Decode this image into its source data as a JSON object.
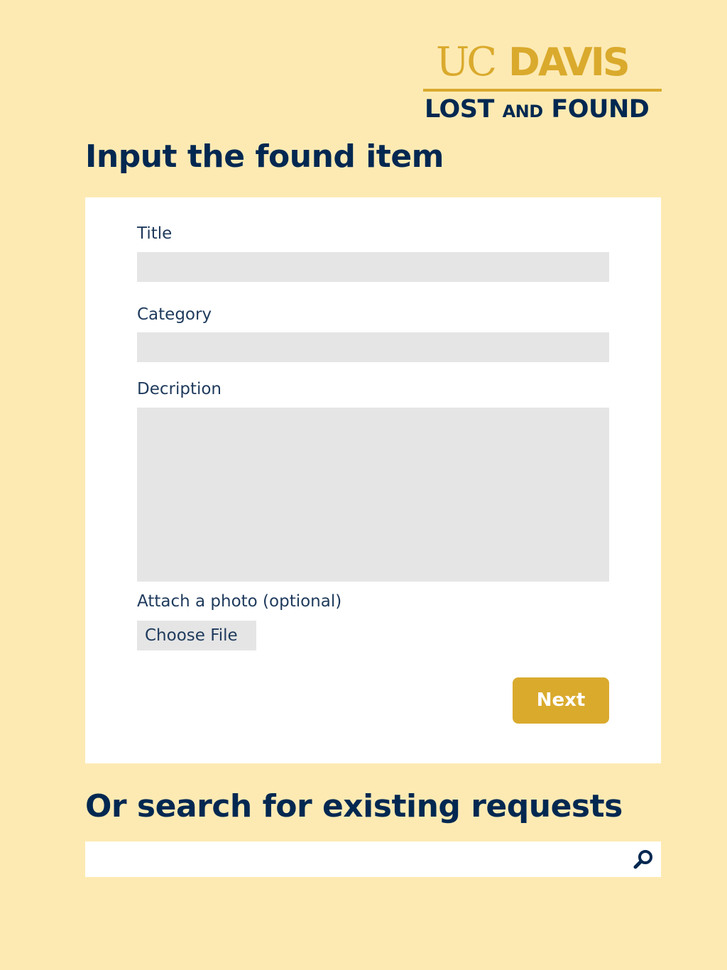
{
  "logo": {
    "uc": "UC",
    "davis": "DAVIS",
    "lost": "LOST",
    "and": "AND",
    "found": "FOUND"
  },
  "form": {
    "heading": "Input the found item",
    "title_label": "Title",
    "title_value": "",
    "category_label": "Category",
    "category_value": "",
    "description_label": "Decription",
    "description_value": "",
    "photo_label": "Attach a photo (optional)",
    "choose_file_label": "Choose File",
    "next_label": "Next"
  },
  "search": {
    "heading": "Or search for existing requests",
    "value": "",
    "icon": "search-icon"
  },
  "colors": {
    "background": "#fdeab3",
    "gold": "#daaa2d",
    "navy": "#022851",
    "field": "#e5e5e5"
  }
}
